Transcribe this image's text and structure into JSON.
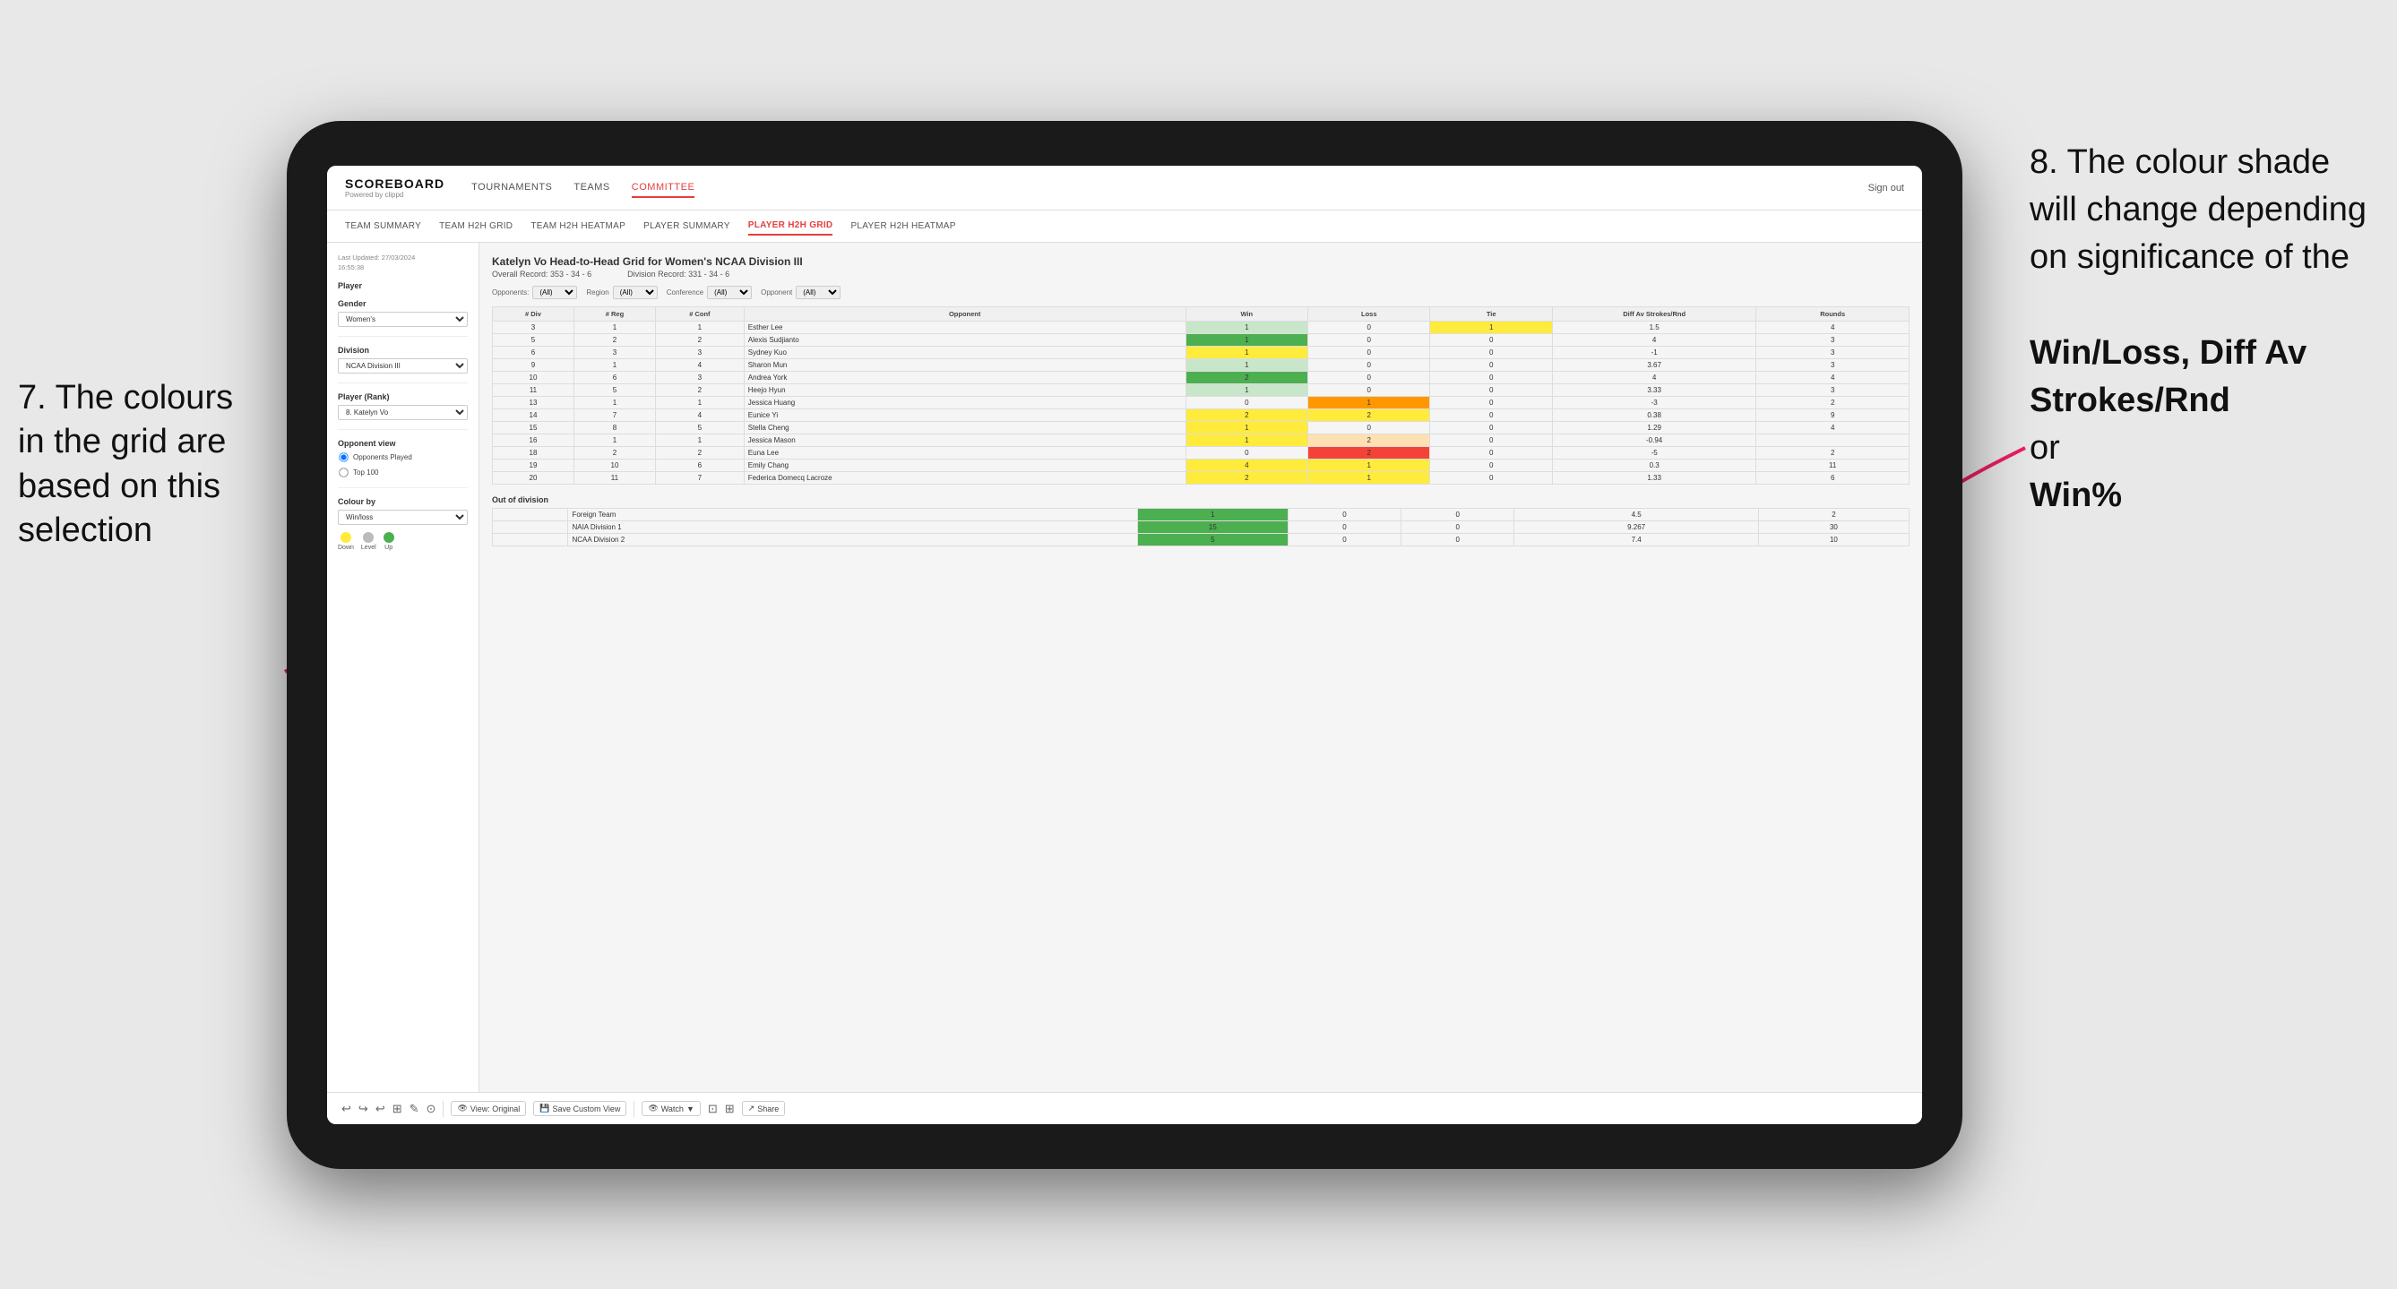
{
  "annotations": {
    "left_title": "7. The colours in the grid are based on this selection",
    "right_title": "8. The colour shade will change depending on significance of the",
    "right_bold1": "Win/Loss,",
    "right_bold2": "Diff Av Strokes/Rnd",
    "right_conjunction": "or",
    "right_bold3": "Win%"
  },
  "nav": {
    "logo": "SCOREBOARD",
    "logo_sub": "Powered by clippd",
    "items": [
      "TOURNAMENTS",
      "TEAMS",
      "COMMITTEE"
    ],
    "active": "COMMITTEE",
    "sign_in": "Sign out"
  },
  "subnav": {
    "items": [
      "TEAM SUMMARY",
      "TEAM H2H GRID",
      "TEAM H2H HEATMAP",
      "PLAYER SUMMARY",
      "PLAYER H2H GRID",
      "PLAYER H2H HEATMAP"
    ],
    "active": "PLAYER H2H GRID"
  },
  "sidebar": {
    "last_updated": "Last Updated: 27/03/2024\n16:55:38",
    "player_label": "Player",
    "gender_label": "Gender",
    "gender_value": "Women's",
    "division_label": "Division",
    "division_value": "NCAA Division III",
    "player_rank_label": "Player (Rank)",
    "player_rank_value": "8. Katelyn Vo",
    "opponent_view_label": "Opponent view",
    "opponent_played": "Opponents Played",
    "top_100": "Top 100",
    "colour_by_label": "Colour by",
    "colour_by_value": "Win/loss",
    "legend": {
      "down_label": "Down",
      "level_label": "Level",
      "up_label": "Up"
    }
  },
  "grid": {
    "title": "Katelyn Vo Head-to-Head Grid for Women's NCAA Division III",
    "overall_record_label": "Overall Record:",
    "overall_record_value": "353 - 34 - 6",
    "division_record_label": "Division Record:",
    "division_record_value": "331 - 34 - 6",
    "filter_opponents_label": "Opponents:",
    "filter_region_label": "Region",
    "filter_conference_label": "Conference",
    "filter_opponent_label": "Opponent",
    "filter_all": "(All)",
    "col_headers": {
      "div": "# Div",
      "reg": "# Reg",
      "conf": "# Conf",
      "opponent": "Opponent",
      "win": "Win",
      "loss": "Loss",
      "tie": "Tie",
      "diff": "Diff Av Strokes/Rnd",
      "rounds": "Rounds"
    },
    "rows": [
      {
        "div": 3,
        "reg": 1,
        "conf": 1,
        "opponent": "Esther Lee",
        "win": 1,
        "loss": 0,
        "tie": 1,
        "diff": 1.5,
        "rounds": 4,
        "win_class": "win-green-light",
        "loss_class": "",
        "tie_class": "win-yellow"
      },
      {
        "div": 5,
        "reg": 2,
        "conf": 2,
        "opponent": "Alexis Sudjianto",
        "win": 1,
        "loss": 0,
        "tie": 0,
        "diff": 4.0,
        "rounds": 3,
        "win_class": "win-green-dark",
        "loss_class": "",
        "tie_class": ""
      },
      {
        "div": 6,
        "reg": 3,
        "conf": 3,
        "opponent": "Sydney Kuo",
        "win": 1,
        "loss": 0,
        "tie": 0,
        "diff": -1.0,
        "rounds": 3,
        "win_class": "win-yellow",
        "loss_class": "",
        "tie_class": ""
      },
      {
        "div": 9,
        "reg": 1,
        "conf": 4,
        "opponent": "Sharon Mun",
        "win": 1,
        "loss": 0,
        "tie": 0,
        "diff": 3.67,
        "rounds": 3,
        "win_class": "win-green-light",
        "loss_class": "",
        "tie_class": ""
      },
      {
        "div": 10,
        "reg": 6,
        "conf": 3,
        "opponent": "Andrea York",
        "win": 2,
        "loss": 0,
        "tie": 0,
        "diff": 4.0,
        "rounds": 4,
        "win_class": "win-green-dark",
        "loss_class": "",
        "tie_class": ""
      },
      {
        "div": 11,
        "reg": 5,
        "conf": 2,
        "opponent": "Heejo Hyun",
        "win": 1,
        "loss": 0,
        "tie": 0,
        "diff": 3.33,
        "rounds": 3,
        "win_class": "win-green-light",
        "loss_class": "",
        "tie_class": ""
      },
      {
        "div": 13,
        "reg": 1,
        "conf": 1,
        "opponent": "Jessica Huang",
        "win": 0,
        "loss": 1,
        "tie": 0,
        "diff": -3.0,
        "rounds": 2,
        "win_class": "",
        "loss_class": "loss-orange",
        "tie_class": ""
      },
      {
        "div": 14,
        "reg": 7,
        "conf": 4,
        "opponent": "Eunice Yi",
        "win": 2,
        "loss": 2,
        "tie": 0,
        "diff": 0.38,
        "rounds": 9,
        "win_class": "win-yellow",
        "loss_class": "win-yellow",
        "tie_class": ""
      },
      {
        "div": 15,
        "reg": 8,
        "conf": 5,
        "opponent": "Stella Cheng",
        "win": 1,
        "loss": 0,
        "tie": 0,
        "diff": 1.29,
        "rounds": 4,
        "win_class": "win-yellow",
        "loss_class": "",
        "tie_class": ""
      },
      {
        "div": 16,
        "reg": 1,
        "conf": 1,
        "opponent": "Jessica Mason",
        "win": 1,
        "loss": 2,
        "tie": 0,
        "diff": -0.94,
        "rounds": "",
        "win_class": "win-yellow",
        "loss_class": "loss-orange-light",
        "tie_class": ""
      },
      {
        "div": 18,
        "reg": 2,
        "conf": 2,
        "opponent": "Euna Lee",
        "win": 0,
        "loss": 2,
        "tie": 0,
        "diff": -5.0,
        "rounds": 2,
        "win_class": "",
        "loss_class": "loss-red",
        "tie_class": ""
      },
      {
        "div": 19,
        "reg": 10,
        "conf": 6,
        "opponent": "Emily Chang",
        "win": 4,
        "loss": 1,
        "tie": 0,
        "diff": 0.3,
        "rounds": 11,
        "win_class": "win-yellow",
        "loss_class": "win-yellow",
        "tie_class": ""
      },
      {
        "div": 20,
        "reg": 11,
        "conf": 7,
        "opponent": "Federica Domecq Lacroze",
        "win": 2,
        "loss": 1,
        "tie": 0,
        "diff": 1.33,
        "rounds": 6,
        "win_class": "win-yellow",
        "loss_class": "win-yellow",
        "tie_class": ""
      }
    ],
    "out_of_division_label": "Out of division",
    "out_division_rows": [
      {
        "label": "Foreign Team",
        "win": 1,
        "loss": 0,
        "tie": 0,
        "diff": 4.5,
        "rounds": 2,
        "win_class": "win-green-dark",
        "loss_class": "",
        "tie_class": ""
      },
      {
        "label": "NAIA Division 1",
        "win": 15,
        "loss": 0,
        "tie": 0,
        "diff": 9.267,
        "rounds": 30,
        "win_class": "win-green-dark",
        "loss_class": "",
        "tie_class": ""
      },
      {
        "label": "NCAA Division 2",
        "win": 5,
        "loss": 0,
        "tie": 0,
        "diff": 7.4,
        "rounds": 10,
        "win_class": "win-green-dark",
        "loss_class": "",
        "tie_class": ""
      }
    ]
  },
  "toolbar": {
    "view_original": "View: Original",
    "save_custom": "Save Custom View",
    "watch": "Watch",
    "share": "Share"
  }
}
